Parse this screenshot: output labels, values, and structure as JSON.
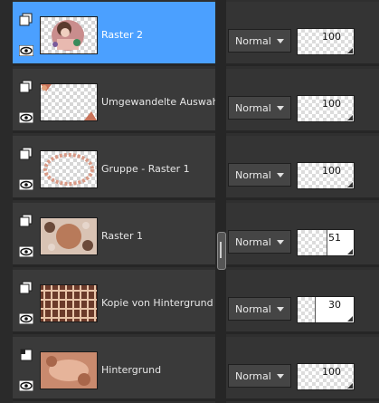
{
  "layers": [
    {
      "name": "Raster 2",
      "type": "raster",
      "selected": true,
      "blend": "Normal",
      "opacity": 100,
      "thumb": "portrait"
    },
    {
      "name": "Umgewandelte Auswahl",
      "type": "raster",
      "selected": false,
      "blend": "Normal",
      "opacity": 100,
      "thumb": "frame"
    },
    {
      "name": "Gruppe - Raster 1",
      "type": "group",
      "selected": false,
      "blend": "Normal",
      "opacity": 100,
      "thumb": "frame"
    },
    {
      "name": "Raster 1",
      "type": "raster",
      "selected": false,
      "blend": "Normal",
      "opacity": 51,
      "thumb": "pattern"
    },
    {
      "name": "Kopie von Hintergrund",
      "type": "raster",
      "selected": false,
      "blend": "Normal",
      "opacity": 30,
      "thumb": "plaid"
    },
    {
      "name": "Hintergrund",
      "type": "background",
      "selected": false,
      "blend": "Normal",
      "opacity": 100,
      "thumb": "texture"
    }
  ],
  "colors": {
    "selection": "#4ba0ff",
    "panel": "#3a3a3a"
  },
  "icons": {
    "layer_type": "layer-stack-icon",
    "visibility": "eye-icon",
    "blend_dropdown": "chevron-down-icon"
  }
}
